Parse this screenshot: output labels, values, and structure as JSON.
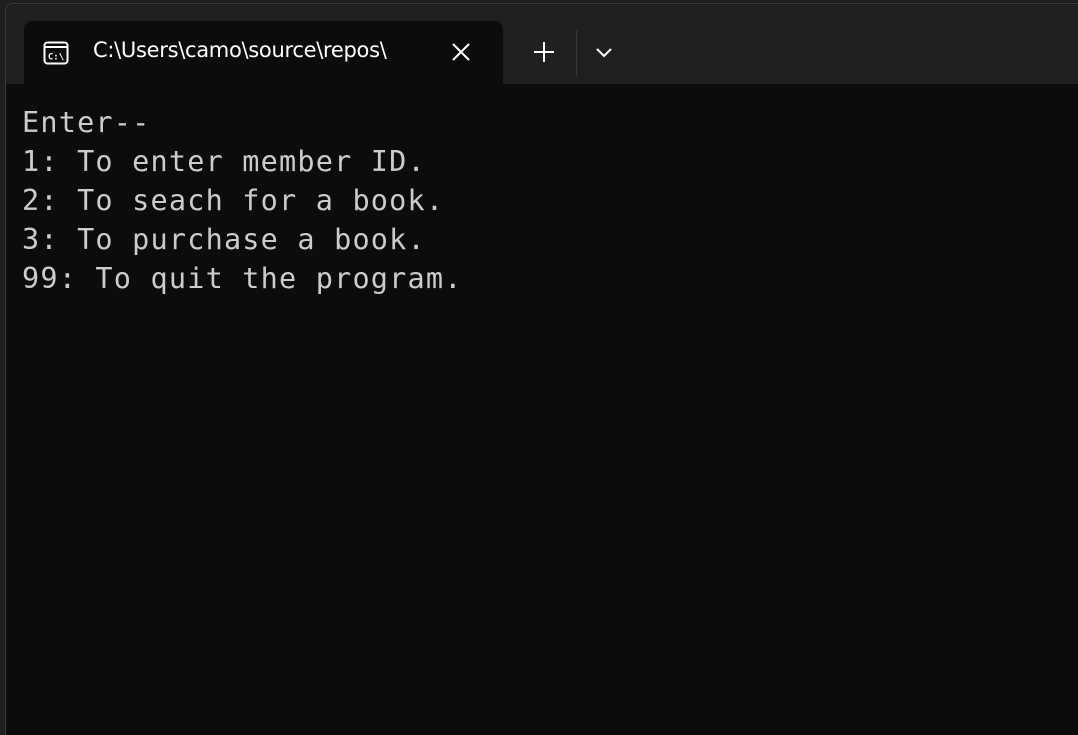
{
  "window": {
    "tab": {
      "title": "C:\\Users\\camo\\source\\repos\\",
      "icon": "console-icon",
      "icon_text": "C:\\"
    },
    "buttons": {
      "close_tab": "close-icon",
      "new_tab": "plus-icon",
      "dropdown": "chevron-down-icon"
    }
  },
  "console": {
    "lines": [
      "Enter--",
      "1: To enter member ID.",
      "2: To seach for a book.",
      "3: To purchase a book.",
      "99: To quit the program."
    ]
  },
  "colors": {
    "console_bg": "#0c0c0c",
    "titlebar_bg": "#202020",
    "console_text": "#cccccc",
    "tab_text": "#ffffff"
  }
}
